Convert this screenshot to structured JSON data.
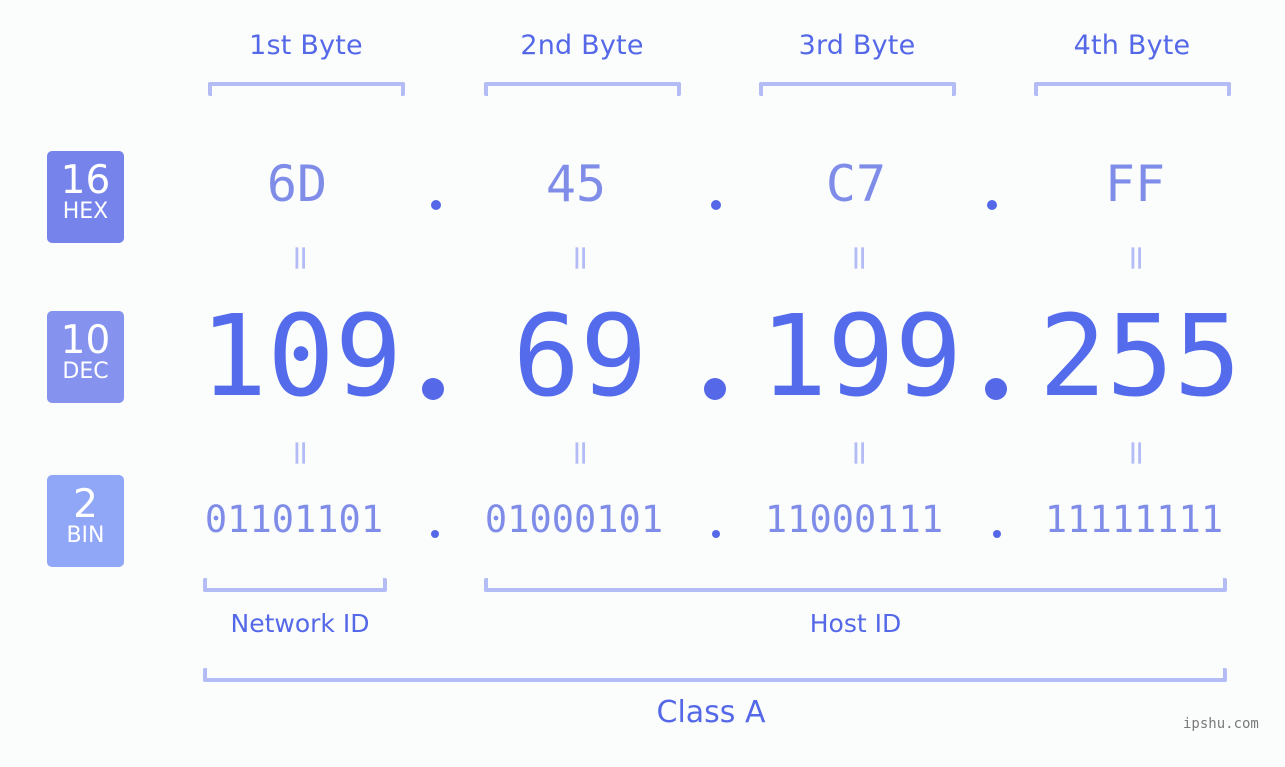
{
  "ip_address": "109.69.199.255",
  "bytes": [
    {
      "header": "1st Byte",
      "hex": "6D",
      "dec": "109",
      "bin": "01101101"
    },
    {
      "header": "2nd Byte",
      "hex": "45",
      "dec": "69",
      "bin": "01000101"
    },
    {
      "header": "3rd Byte",
      "hex": "C7",
      "dec": "199",
      "bin": "11000111"
    },
    {
      "header": "4th Byte",
      "hex": "FF",
      "dec": "255",
      "bin": "11111111"
    }
  ],
  "badges": {
    "hex": {
      "number": "16",
      "label": "HEX",
      "color": "#7583ea"
    },
    "dec": {
      "number": "10",
      "label": "DEC",
      "color": "#8593ef"
    },
    "bin": {
      "number": "2",
      "label": "BIN",
      "color": "#90a6f7"
    }
  },
  "equals_symbol": "=",
  "separator": ".",
  "network_id_label": "Network ID",
  "host_id_label": "Host ID",
  "class_label": "Class A",
  "watermark": "ipshu.com",
  "colors": {
    "primary": "#546cec",
    "secondary": "#7f8de9",
    "bracket": "#b3bcf5",
    "background": "#fbfdfc"
  }
}
